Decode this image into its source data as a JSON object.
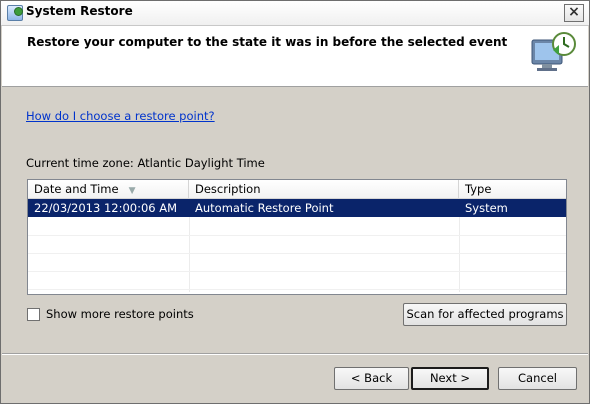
{
  "window": {
    "title": "System Restore",
    "close_glyph": "×"
  },
  "header": {
    "title": "Restore your computer to the state it was in before the selected event",
    "icon": "system-restore-icon"
  },
  "help_link": "How do I choose a restore point?",
  "timezone_text": "Current time zone: Atlantic Daylight Time",
  "table": {
    "columns": [
      "Date and Time",
      "Description",
      "Type"
    ],
    "rows": [
      {
        "date": "22/03/2013 12:00:06 AM",
        "description": "Automatic Restore Point",
        "type": "System",
        "selected": true
      }
    ]
  },
  "show_more_label": "Show more restore points",
  "scan_button": "Scan for affected programs",
  "buttons": {
    "back": "< Back",
    "next": "Next >",
    "cancel": "Cancel"
  },
  "colors": {
    "selection": "#0a246a",
    "link": "#0033cc",
    "background": "#d4d0c8"
  }
}
